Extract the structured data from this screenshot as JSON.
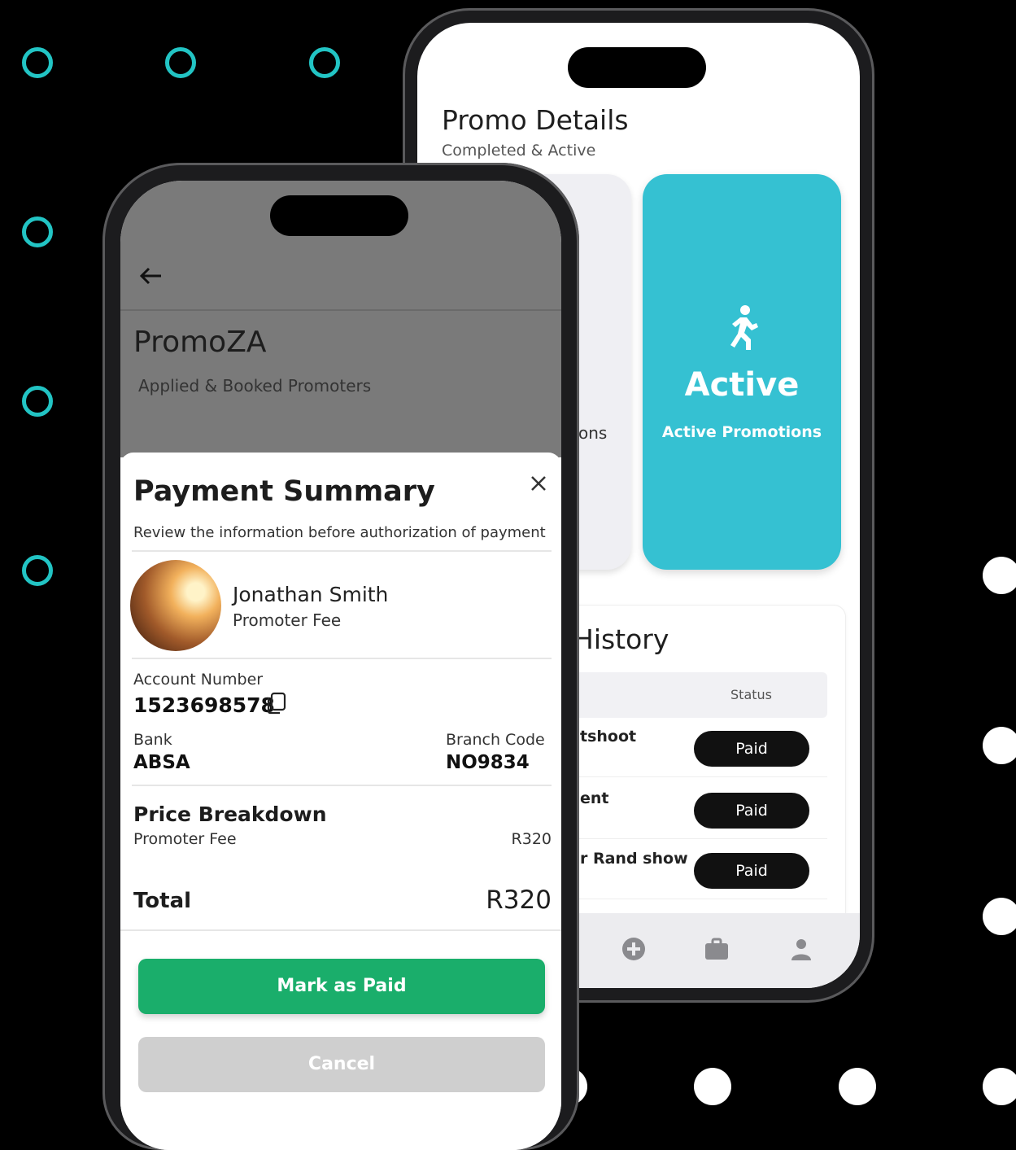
{
  "colors": {
    "accent_teal": "#35c1d2",
    "ring_teal": "#22c4c4",
    "button_green": "#1aae6b",
    "cancel_gray": "#cfcfcf",
    "pill_black": "#111111"
  },
  "back_screen": {
    "title": "Promo Details",
    "subtitle": "Completed & Active",
    "completed_card_partial": "ons",
    "active_card": {
      "icon": "running-person-icon",
      "heading": "Active",
      "label": "Active Promotions"
    },
    "history": {
      "title": "History",
      "column_status": "Status",
      "rows": [
        {
          "name": "tshoot",
          "status": "Paid"
        },
        {
          "name": "ent",
          "status": "Paid"
        },
        {
          "name": "r Rand show",
          "status": "Paid"
        }
      ]
    },
    "nav_icons": [
      "plus-circle-icon",
      "briefcase-icon",
      "person-icon"
    ]
  },
  "front_screen": {
    "app_title": "PromoZA",
    "app_subtitle": "Applied & Booked Promoters",
    "payment_summary": {
      "title": "Payment Summary",
      "subtitle": "Review the information before authorization of payment",
      "person_name": "Jonathan Smith",
      "person_role": "Promoter Fee",
      "account_label": "Account Number",
      "account_number": "1523698578",
      "bank_label": "Bank",
      "bank_value": "ABSA",
      "branch_label": "Branch Code",
      "branch_value": "NO9834",
      "breakdown_title": "Price Breakdown",
      "breakdown_item": "Promoter Fee",
      "breakdown_amount": "R320",
      "total_label": "Total",
      "total_amount": "R320",
      "primary_button": "Mark as Paid",
      "secondary_button": "Cancel"
    }
  }
}
